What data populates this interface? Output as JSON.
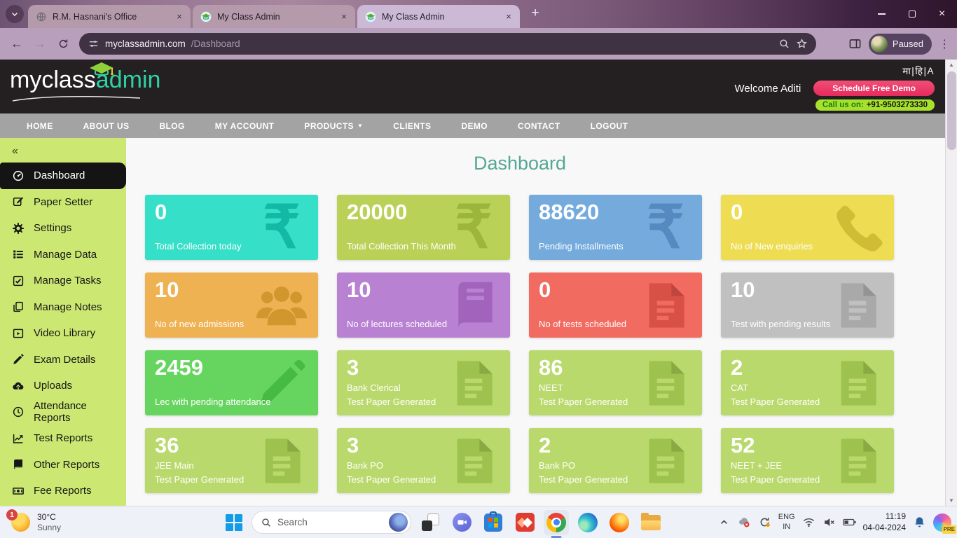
{
  "colors": {
    "sidebar_green": "#cde872",
    "header_dark": "#242021",
    "nav_gray": "#a3a3a3",
    "demo_pink": "#e62a5d",
    "call_green": "#a6e22c",
    "title_teal": "#55a794",
    "taskbar_bg": "#eef2f8"
  },
  "browser": {
    "tabs": [
      {
        "title": "R.M. Hasnani's Office",
        "favicon": "globe-icon",
        "active": false
      },
      {
        "title": "My Class Admin",
        "favicon": "gradcap-icon",
        "active": false
      },
      {
        "title": "My Class Admin",
        "favicon": "gradcap-icon",
        "active": true
      }
    ],
    "url_host": "myclassadmin.com",
    "url_path": "/Dashboard",
    "profile_label": "Paused"
  },
  "header": {
    "logo_text_1": "myclass",
    "logo_text_2": "admin",
    "language_switcher": "मा|हि|A",
    "welcome_text": "Welcome Aditi",
    "demo_button_label": "Schedule Free Demo",
    "call_label": "Call us on:",
    "call_number": "+91-9503273330"
  },
  "nav": {
    "items": [
      {
        "label": "HOME"
      },
      {
        "label": "ABOUT US"
      },
      {
        "label": "BLOG"
      },
      {
        "label": "MY ACCOUNT"
      },
      {
        "label": "PRODUCTS",
        "caret": "▼"
      },
      {
        "label": "CLIENTS"
      },
      {
        "label": "DEMO"
      },
      {
        "label": "CONTACT"
      },
      {
        "label": "LOGOUT"
      }
    ]
  },
  "sidebar": {
    "collapse_glyph": "«",
    "items": [
      {
        "label": "Dashboard",
        "icon": "dashboard-icon",
        "active": true
      },
      {
        "label": "Paper Setter",
        "icon": "edit-square-icon"
      },
      {
        "label": "Settings",
        "icon": "gear-icon"
      },
      {
        "label": "Manage Data",
        "icon": "list-icon"
      },
      {
        "label": "Manage Tasks",
        "icon": "check-square-icon"
      },
      {
        "label": "Manage Notes",
        "icon": "copy-icon"
      },
      {
        "label": "Video Library",
        "icon": "video-icon"
      },
      {
        "label": "Exam Details",
        "icon": "pencil-icon"
      },
      {
        "label": "Uploads",
        "icon": "cloud-upload-icon"
      },
      {
        "label": "Attendance Reports",
        "icon": "clock-icon"
      },
      {
        "label": "Test Reports",
        "icon": "chart-icon"
      },
      {
        "label": "Other Reports",
        "icon": "book-icon"
      },
      {
        "label": "Fee Reports",
        "icon": "money-icon"
      }
    ]
  },
  "main": {
    "title": "Dashboard",
    "cards": [
      {
        "value": "0",
        "label": "Total Collection today",
        "bg": "#36dfc8",
        "icon_color": "#14b9a5",
        "icon": "rupee-icon"
      },
      {
        "value": "20000",
        "label": "Total Collection This Month",
        "bg": "#b9d157",
        "icon_color": "#9cb53b",
        "icon": "rupee-icon"
      },
      {
        "value": "88620",
        "label": "Pending Installments",
        "bg": "#74aadc",
        "icon_color": "#5589c0",
        "icon": "rupee-icon"
      },
      {
        "value": "0",
        "label": "No of New enquiries",
        "bg": "#eedd52",
        "icon_color": "#d0bd35",
        "icon": "phone-icon"
      },
      {
        "value": "10",
        "label": "No of new admissions",
        "bg": "#eeb253",
        "icon_color": "#d2962f",
        "icon": "users-icon"
      },
      {
        "value": "10",
        "label": "No of lectures scheduled",
        "bg": "#b981d2",
        "icon_color": "#a263bd",
        "icon": "lecture-book-icon"
      },
      {
        "value": "0",
        "label": "No of tests scheduled",
        "bg": "#f26b61",
        "icon_color": "#d85046",
        "icon": "file-icon"
      },
      {
        "value": "10",
        "label": "Test with pending results",
        "bg": "#c0c0c0",
        "icon_color": "#a9a9a9",
        "icon": "file-icon"
      },
      {
        "value": "2459",
        "label": "Lec with pending attendance",
        "bg": "#66d55f",
        "icon_color": "#47bb41",
        "icon": "pencil-icon"
      },
      {
        "value": "3",
        "label": "Bank Clerical",
        "label2": "Test Paper Generated",
        "bg": "#b9d96c",
        "icon_color": "#9dc24d",
        "icon": "file-icon"
      },
      {
        "value": "86",
        "label": "NEET",
        "label2": "Test Paper Generated",
        "bg": "#b9d96c",
        "icon_color": "#9dc24d",
        "icon": "file-icon"
      },
      {
        "value": "2",
        "label": "CAT",
        "label2": "Test Paper Generated",
        "bg": "#b9d96c",
        "icon_color": "#9dc24d",
        "icon": "file-icon"
      },
      {
        "value": "36",
        "label": "JEE Main",
        "label2": "Test Paper Generated",
        "bg": "#b9d96c",
        "icon_color": "#9dc24d",
        "icon": "file-icon"
      },
      {
        "value": "3",
        "label": "Bank PO",
        "label2": "Test Paper Generated",
        "bg": "#b9d96c",
        "icon_color": "#9dc24d",
        "icon": "file-icon"
      },
      {
        "value": "2",
        "label": "Bank PO",
        "label2": "Test Paper Generated",
        "bg": "#b9d96c",
        "icon_color": "#9dc24d",
        "icon": "file-icon"
      },
      {
        "value": "52",
        "label": "NEET + JEE",
        "label2": "Test Paper Generated",
        "bg": "#b9d96c",
        "icon_color": "#9dc24d",
        "icon": "file-icon"
      }
    ]
  },
  "taskbar": {
    "weather": {
      "temp": "30°C",
      "condition": "Sunny",
      "badge": "1"
    },
    "search_label": "Search",
    "apps": [
      {
        "icon": "task-view-icon"
      },
      {
        "icon": "chat-icon"
      },
      {
        "icon": "store-icon"
      },
      {
        "icon": "red-diamond-app-icon"
      },
      {
        "icon": "chrome-icon",
        "active": true
      },
      {
        "icon": "edge-icon"
      },
      {
        "icon": "firefox-icon"
      },
      {
        "icon": "file-explorer-icon"
      }
    ],
    "tray_icon_names": [
      "hidden-icons-chevron-icon",
      "sync-error-icon",
      "update-available-icon",
      "language-indicator",
      "wifi-icon",
      "volume-muted-icon",
      "battery-icon",
      "clock-display",
      "notification-bell-icon",
      "copilot-icon"
    ],
    "tray": {
      "lang_top": "ENG",
      "lang_bottom": "IN",
      "time": "11:19",
      "date": "04-04-2024",
      "copilot_badge": "PRE"
    }
  }
}
